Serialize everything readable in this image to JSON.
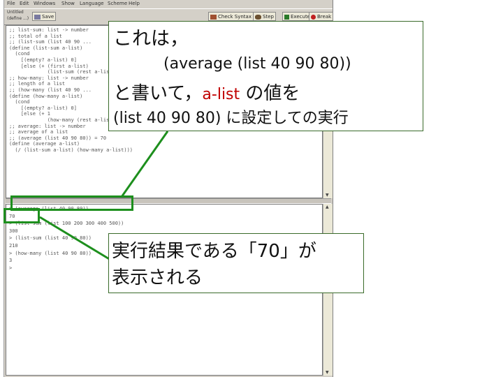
{
  "menu": [
    "File",
    "Edit",
    "Windows",
    "Show",
    "Language",
    "Scheme",
    "Help"
  ],
  "toolbar": {
    "file_label": "Untitled",
    "define_label": "(define ...)",
    "save_label": "Save",
    "check_syntax_label": "Check Syntax",
    "step_label": "Step",
    "execute_label": "Execute",
    "break_label": "Break"
  },
  "definitions": [
    ";; list-sum: list -> number",
    ";; total of a list",
    ";; (list-sum (list 40 90 ...",
    "(define (list-sum a-list)",
    "  (cond",
    "    [(empty? a-list) 0]",
    "    [else (+ (first a-list)",
    "             (list-sum (rest a-list)))]))",
    ";; how-many: list -> number",
    ";; length of a list",
    ";; (how-many (list 40 90 ...",
    "(define (how-many a-list)",
    "  (cond",
    "    [(empty? a-list) 0]",
    "    [else (+ 1",
    "             (how-many (rest a-list)))]))",
    ";; average: list -> number",
    ";; average of a list",
    ";; (average (list 40 90 80)) = 70",
    "(define (average a-list)",
    "  (/ (list-sum a-list) (how-many a-list)))"
  ],
  "interactions": [
    "> (average (list 40 90 80))",
    "70",
    "> (list-sum (list 100 200 300 400 500))",
    "300",
    "> (list-sum (list 40 90 80))",
    "210",
    "> (how-many (list 40 90 80))",
    "3",
    ">"
  ],
  "callout1": {
    "line1": "これは，",
    "line2": "(average (list 40 90 80))",
    "line3_a": "と書いて，",
    "line3_b": "a-list",
    "line3_c": " の値を",
    "line4": "(list 40 90 80) に設定しての実行"
  },
  "callout2": {
    "line1": "実行結果である「70」が",
    "line2": "表示される"
  },
  "colors": {
    "highlight": "#1d8f1d",
    "accent_red": "#c00000",
    "callout_border": "#3a6b2a"
  }
}
